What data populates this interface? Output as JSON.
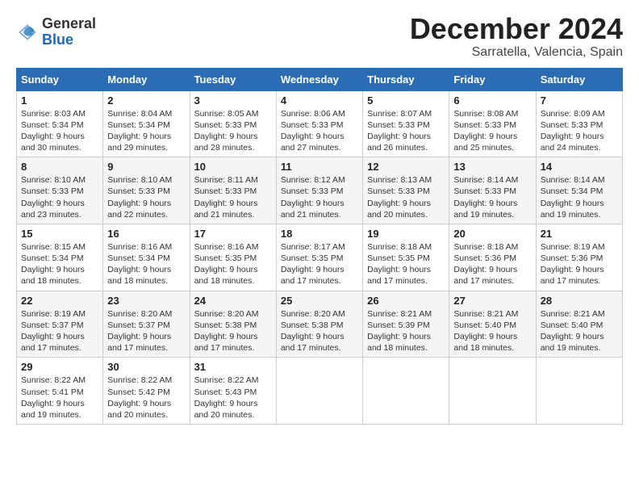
{
  "logo": {
    "general": "General",
    "blue": "Blue"
  },
  "title": "December 2024",
  "location": "Sarratella, Valencia, Spain",
  "headers": [
    "Sunday",
    "Monday",
    "Tuesday",
    "Wednesday",
    "Thursday",
    "Friday",
    "Saturday"
  ],
  "weeks": [
    [
      {
        "day": "1",
        "sunrise": "Sunrise: 8:03 AM",
        "sunset": "Sunset: 5:34 PM",
        "daylight": "Daylight: 9 hours and 30 minutes."
      },
      {
        "day": "2",
        "sunrise": "Sunrise: 8:04 AM",
        "sunset": "Sunset: 5:34 PM",
        "daylight": "Daylight: 9 hours and 29 minutes."
      },
      {
        "day": "3",
        "sunrise": "Sunrise: 8:05 AM",
        "sunset": "Sunset: 5:33 PM",
        "daylight": "Daylight: 9 hours and 28 minutes."
      },
      {
        "day": "4",
        "sunrise": "Sunrise: 8:06 AM",
        "sunset": "Sunset: 5:33 PM",
        "daylight": "Daylight: 9 hours and 27 minutes."
      },
      {
        "day": "5",
        "sunrise": "Sunrise: 8:07 AM",
        "sunset": "Sunset: 5:33 PM",
        "daylight": "Daylight: 9 hours and 26 minutes."
      },
      {
        "day": "6",
        "sunrise": "Sunrise: 8:08 AM",
        "sunset": "Sunset: 5:33 PM",
        "daylight": "Daylight: 9 hours and 25 minutes."
      },
      {
        "day": "7",
        "sunrise": "Sunrise: 8:09 AM",
        "sunset": "Sunset: 5:33 PM",
        "daylight": "Daylight: 9 hours and 24 minutes."
      }
    ],
    [
      {
        "day": "8",
        "sunrise": "Sunrise: 8:10 AM",
        "sunset": "Sunset: 5:33 PM",
        "daylight": "Daylight: 9 hours and 23 minutes."
      },
      {
        "day": "9",
        "sunrise": "Sunrise: 8:10 AM",
        "sunset": "Sunset: 5:33 PM",
        "daylight": "Daylight: 9 hours and 22 minutes."
      },
      {
        "day": "10",
        "sunrise": "Sunrise: 8:11 AM",
        "sunset": "Sunset: 5:33 PM",
        "daylight": "Daylight: 9 hours and 21 minutes."
      },
      {
        "day": "11",
        "sunrise": "Sunrise: 8:12 AM",
        "sunset": "Sunset: 5:33 PM",
        "daylight": "Daylight: 9 hours and 21 minutes."
      },
      {
        "day": "12",
        "sunrise": "Sunrise: 8:13 AM",
        "sunset": "Sunset: 5:33 PM",
        "daylight": "Daylight: 9 hours and 20 minutes."
      },
      {
        "day": "13",
        "sunrise": "Sunrise: 8:14 AM",
        "sunset": "Sunset: 5:33 PM",
        "daylight": "Daylight: 9 hours and 19 minutes."
      },
      {
        "day": "14",
        "sunrise": "Sunrise: 8:14 AM",
        "sunset": "Sunset: 5:34 PM",
        "daylight": "Daylight: 9 hours and 19 minutes."
      }
    ],
    [
      {
        "day": "15",
        "sunrise": "Sunrise: 8:15 AM",
        "sunset": "Sunset: 5:34 PM",
        "daylight": "Daylight: 9 hours and 18 minutes."
      },
      {
        "day": "16",
        "sunrise": "Sunrise: 8:16 AM",
        "sunset": "Sunset: 5:34 PM",
        "daylight": "Daylight: 9 hours and 18 minutes."
      },
      {
        "day": "17",
        "sunrise": "Sunrise: 8:16 AM",
        "sunset": "Sunset: 5:35 PM",
        "daylight": "Daylight: 9 hours and 18 minutes."
      },
      {
        "day": "18",
        "sunrise": "Sunrise: 8:17 AM",
        "sunset": "Sunset: 5:35 PM",
        "daylight": "Daylight: 9 hours and 17 minutes."
      },
      {
        "day": "19",
        "sunrise": "Sunrise: 8:18 AM",
        "sunset": "Sunset: 5:35 PM",
        "daylight": "Daylight: 9 hours and 17 minutes."
      },
      {
        "day": "20",
        "sunrise": "Sunrise: 8:18 AM",
        "sunset": "Sunset: 5:36 PM",
        "daylight": "Daylight: 9 hours and 17 minutes."
      },
      {
        "day": "21",
        "sunrise": "Sunrise: 8:19 AM",
        "sunset": "Sunset: 5:36 PM",
        "daylight": "Daylight: 9 hours and 17 minutes."
      }
    ],
    [
      {
        "day": "22",
        "sunrise": "Sunrise: 8:19 AM",
        "sunset": "Sunset: 5:37 PM",
        "daylight": "Daylight: 9 hours and 17 minutes."
      },
      {
        "day": "23",
        "sunrise": "Sunrise: 8:20 AM",
        "sunset": "Sunset: 5:37 PM",
        "daylight": "Daylight: 9 hours and 17 minutes."
      },
      {
        "day": "24",
        "sunrise": "Sunrise: 8:20 AM",
        "sunset": "Sunset: 5:38 PM",
        "daylight": "Daylight: 9 hours and 17 minutes."
      },
      {
        "day": "25",
        "sunrise": "Sunrise: 8:20 AM",
        "sunset": "Sunset: 5:38 PM",
        "daylight": "Daylight: 9 hours and 17 minutes."
      },
      {
        "day": "26",
        "sunrise": "Sunrise: 8:21 AM",
        "sunset": "Sunset: 5:39 PM",
        "daylight": "Daylight: 9 hours and 18 minutes."
      },
      {
        "day": "27",
        "sunrise": "Sunrise: 8:21 AM",
        "sunset": "Sunset: 5:40 PM",
        "daylight": "Daylight: 9 hours and 18 minutes."
      },
      {
        "day": "28",
        "sunrise": "Sunrise: 8:21 AM",
        "sunset": "Sunset: 5:40 PM",
        "daylight": "Daylight: 9 hours and 19 minutes."
      }
    ],
    [
      {
        "day": "29",
        "sunrise": "Sunrise: 8:22 AM",
        "sunset": "Sunset: 5:41 PM",
        "daylight": "Daylight: 9 hours and 19 minutes."
      },
      {
        "day": "30",
        "sunrise": "Sunrise: 8:22 AM",
        "sunset": "Sunset: 5:42 PM",
        "daylight": "Daylight: 9 hours and 20 minutes."
      },
      {
        "day": "31",
        "sunrise": "Sunrise: 8:22 AM",
        "sunset": "Sunset: 5:43 PM",
        "daylight": "Daylight: 9 hours and 20 minutes."
      },
      null,
      null,
      null,
      null
    ]
  ]
}
